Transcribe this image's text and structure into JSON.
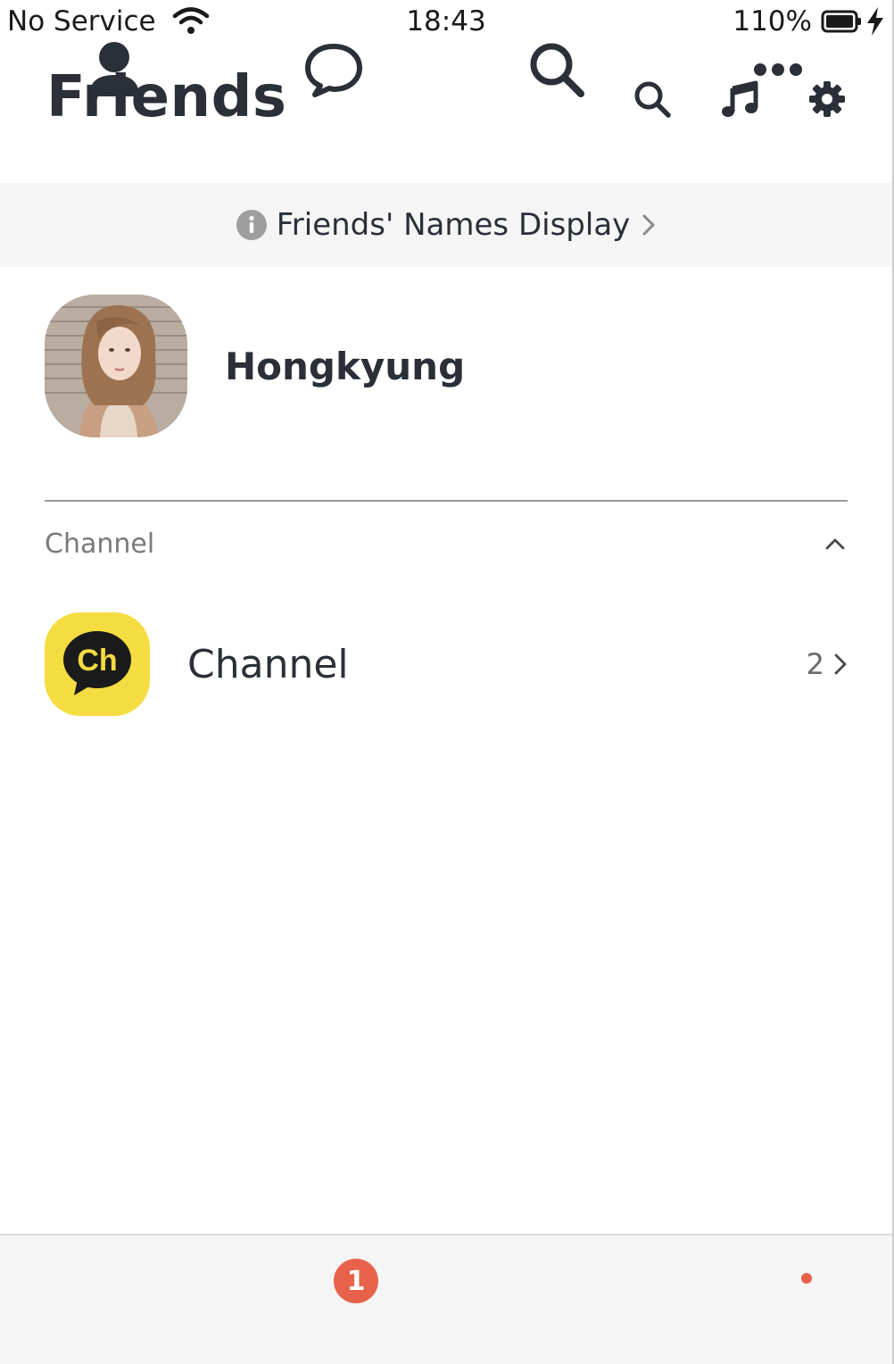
{
  "status_bar": {
    "carrier": "No Service",
    "time": "18:43",
    "battery": "110%"
  },
  "header": {
    "title": "Friends",
    "icons": [
      "search-icon",
      "music-note-icon",
      "gear-icon"
    ]
  },
  "banner": {
    "text": "Friends' Names Display"
  },
  "profile": {
    "name": "Hongkyung"
  },
  "section": {
    "label": "Channel"
  },
  "channel": {
    "name": "Channel",
    "logo_text": "Ch",
    "count": "2"
  },
  "tabbar": {
    "tabs": [
      "person-icon",
      "chat-icon",
      "search-icon",
      "more-icon"
    ],
    "chat_badge": "1"
  },
  "colors": {
    "text": "#2b2f38",
    "banner_bg": "#f5f5f5",
    "channel_yellow": "#f5dc41",
    "badge": "#e8624b"
  }
}
